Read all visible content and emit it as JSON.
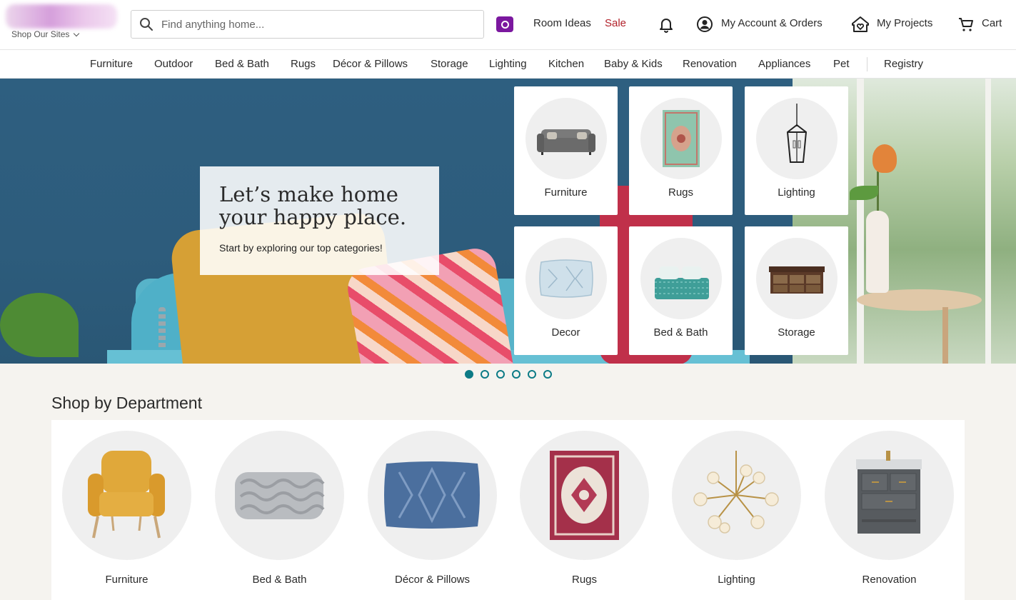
{
  "header": {
    "shop_sites_label": "Shop Our Sites",
    "search_placeholder": "Find anything home...",
    "room_ideas": "Room Ideas",
    "sale": "Sale",
    "account": "My Account & Orders",
    "projects": "My Projects",
    "cart": "Cart",
    "icons": [
      "search-icon",
      "camera-icon",
      "bell-icon",
      "user-icon",
      "heart-house-icon",
      "cart-icon"
    ]
  },
  "nav": {
    "items": [
      "Furniture",
      "Outdoor",
      "Bed & Bath",
      "Rugs",
      "Décor & Pillows",
      "Storage",
      "Lighting",
      "Kitchen",
      "Baby & Kids",
      "Renovation",
      "Appliances",
      "Pet",
      "Registry"
    ]
  },
  "hero": {
    "title": "Let’s make home your happy place.",
    "subtitle": "Start by exploring our top categories!",
    "categories": [
      "Furniture",
      "Rugs",
      "Lighting",
      "Decor",
      "Bed & Bath",
      "Storage"
    ]
  },
  "carousel": {
    "slide_count": 6,
    "active_slide": 1
  },
  "department": {
    "heading": "Shop by Department",
    "items": [
      "Furniture",
      "Bed & Bath",
      "Décor & Pillows",
      "Rugs",
      "Lighting",
      "Renovation"
    ]
  },
  "colors": {
    "brand_purple": "#7b189f",
    "sale_red": "#b2222b",
    "accent_teal": "#0d7b86",
    "hero_wall": "#2e5f80",
    "section_bg": "#f5f3ef"
  }
}
